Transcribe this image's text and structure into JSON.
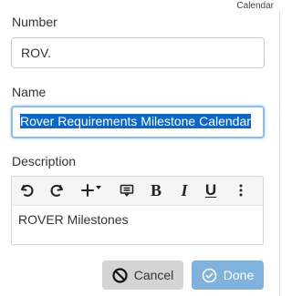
{
  "corner_label": "Calendar",
  "form": {
    "number": {
      "label": "Number",
      "value": "ROV."
    },
    "name": {
      "label": "Name",
      "value": "Rover Requirements Milestone Calendar"
    },
    "description": {
      "label": "Description",
      "content": "ROVER Milestones"
    }
  },
  "toolbar": {
    "bold": "B",
    "italic": "I",
    "underline": "U",
    "icons": [
      "undo-icon",
      "redo-icon",
      "plus-icon",
      "caret-down-icon",
      "comment-icon",
      "more-icon"
    ]
  },
  "buttons": {
    "cancel_label": "Cancel",
    "done_label": "Done"
  },
  "colors": {
    "selection": "#0a67c9",
    "focus_border": "#8fbde8",
    "cancel_bg": "#d4d4d4",
    "done_bg": "#7fb3de"
  }
}
